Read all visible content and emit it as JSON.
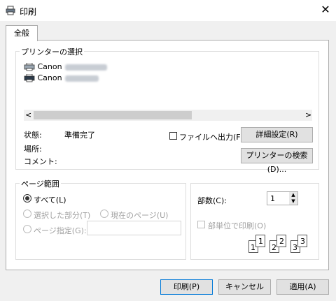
{
  "window": {
    "title": "印刷",
    "close_glyph": "✕",
    "title_icon": "printer-icon"
  },
  "tabs": [
    {
      "label": "全般"
    }
  ],
  "printer_select": {
    "group_title": "プリンターの選択",
    "printers": [
      {
        "name": "Canon",
        "icon": "printer-icon",
        "model_redacted": true
      },
      {
        "name": "Canon",
        "icon": "printer-icon",
        "model_redacted": true
      }
    ],
    "scroll_left": "<",
    "scroll_right": ">"
  },
  "status": {
    "state_label": "状態:",
    "state_value": "準備完了",
    "location_label": "場所:",
    "comment_label": "コメント:",
    "print_to_file_label": "ファイルへ出力(F)",
    "print_to_file_checked": false,
    "preferences_button": "詳細設定(R)",
    "find_printer_button": "プリンターの検索(D)..."
  },
  "page_range": {
    "group_title": "ページ範囲",
    "all_label": "すべて(L)",
    "selection_label": "選択した部分(T)",
    "current_page_label": "現在のページ(U)",
    "pages_label": "ページ指定(G):",
    "pages_value": "",
    "selected": "all"
  },
  "copies": {
    "label": "部数(C):",
    "value": "1",
    "collate_label": "部単位で印刷(O)",
    "collate_checked": false,
    "collate_pages": [
      "1",
      "1",
      "2",
      "2",
      "3",
      "3"
    ]
  },
  "buttons": {
    "print": "印刷(P)",
    "cancel": "キャンセル",
    "apply": "適用(A)"
  }
}
